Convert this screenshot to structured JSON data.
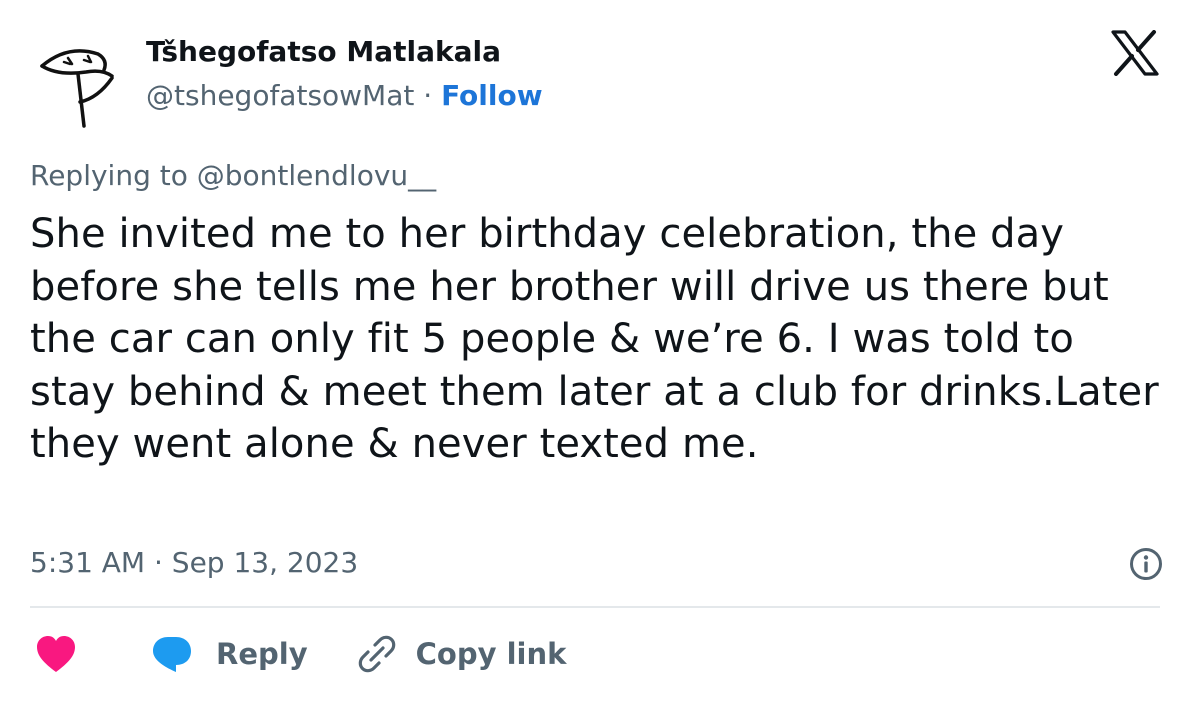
{
  "author": {
    "display_name": "Tšhegofatso Matlakala",
    "handle": "@tshegofatsowMat",
    "separator": " · ",
    "follow_label": "Follow"
  },
  "tweet": {
    "replying_to": "Replying to @bontlendlovu__",
    "text": "She invited me to her birthday celebration, the day before she tells me her brother will drive us there but the car can only fit 5 people & we’re 6. I was told to stay behind & meet them later at a club for drinks.Later they went alone & never texted me.",
    "timestamp": "5:31 AM · Sep 13, 2023"
  },
  "actions": {
    "like_icon": "heart-icon",
    "reply_label": "Reply",
    "copy_link_label": "Copy link"
  },
  "colors": {
    "heart": "#f91880",
    "reply_bubble": "#1d9bf0",
    "follow": "#1d75d8",
    "secondary_text": "#536471",
    "primary_text": "#0f1419"
  }
}
